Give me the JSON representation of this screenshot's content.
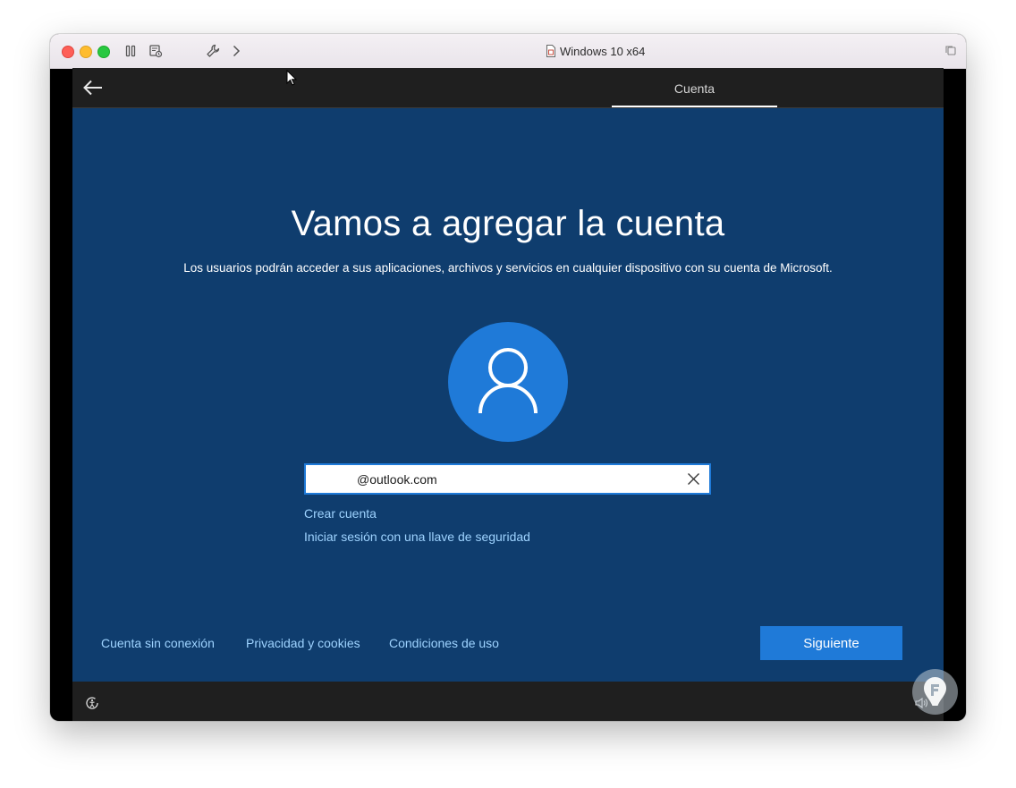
{
  "window": {
    "title": "Windows 10 x64"
  },
  "header": {
    "active_tab": "Cuenta"
  },
  "main": {
    "heading": "Vamos a agregar la cuenta",
    "subtitle": "Los usuarios podrán acceder a sus aplicaciones, archivos y servicios en cualquier dispositivo con su cuenta de Microsoft.",
    "email_value": "@outlook.com",
    "create_account_link": "Crear cuenta",
    "security_key_link": "Iniciar sesión con una llave de seguridad"
  },
  "footer": {
    "offline_account_link": "Cuenta sin conexión",
    "privacy_link": "Privacidad y cookies",
    "terms_link": "Condiciones de uso",
    "next_button": "Siguiente"
  },
  "icons": {
    "back": "arrow-left-icon",
    "avatar": "user-icon",
    "clear": "close-icon",
    "ease_of_access": "ease-of-access-icon",
    "volume": "volume-icon"
  },
  "colors": {
    "oobe_background": "#0f3d6e",
    "accent": "#1f7ad8",
    "link": "#9ed3ff",
    "bar": "#1f1f1f"
  }
}
